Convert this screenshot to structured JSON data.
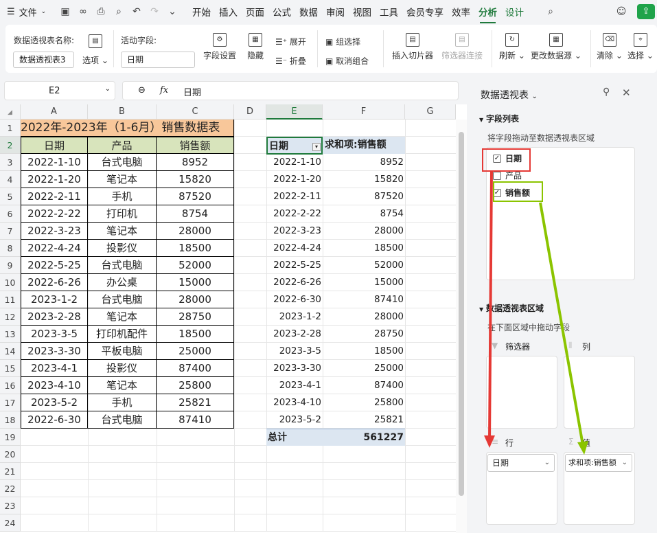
{
  "menu": {
    "file_label": "文件",
    "tabs": [
      "开始",
      "插入",
      "页面",
      "公式",
      "数据",
      "审阅",
      "视图",
      "工具",
      "会员专享",
      "效率",
      "分析",
      "设计"
    ],
    "active_tab": "分析"
  },
  "ribbon": {
    "pivot_name_label": "数据透视表名称:",
    "pivot_name_value": "数据透视表3",
    "options_label": "选项",
    "active_field_label": "活动字段:",
    "active_field_value": "日期",
    "field_settings": "字段设置",
    "hide": "隐藏",
    "expand": "展开",
    "collapse": "折叠",
    "group_select": "组选择",
    "ungroup": "取消组合",
    "insert_slicer": "插入切片器",
    "filter_conn": "筛选器连接",
    "refresh": "刷新",
    "change_source": "更改数据源",
    "clear": "清除",
    "select": "选择"
  },
  "formula_bar": {
    "cell_ref": "E2",
    "fx": "fx",
    "value": "日期"
  },
  "sheet": {
    "columns": [
      "A",
      "B",
      "C",
      "D",
      "E",
      "F",
      "G"
    ],
    "rows": [
      "1",
      "2",
      "3",
      "4",
      "5",
      "6",
      "7",
      "8",
      "9",
      "10",
      "11",
      "12",
      "13",
      "14",
      "15",
      "16",
      "17",
      "18",
      "19",
      "20",
      "21",
      "22",
      "23",
      "24"
    ],
    "title": "2022年-2023年（1-6月）销售数据表",
    "headers": [
      "日期",
      "产品",
      "销售额"
    ],
    "data": [
      [
        "2022-1-10",
        "台式电脑",
        "8952"
      ],
      [
        "2022-1-20",
        "笔记本",
        "15820"
      ],
      [
        "2022-2-11",
        "手机",
        "87520"
      ],
      [
        "2022-2-22",
        "打印机",
        "8754"
      ],
      [
        "2022-3-23",
        "笔记本",
        "28000"
      ],
      [
        "2022-4-24",
        "投影仪",
        "18500"
      ],
      [
        "2022-5-25",
        "台式电脑",
        "52000"
      ],
      [
        "2022-6-26",
        "办公桌",
        "15000"
      ],
      [
        "2023-1-2",
        "台式电脑",
        "28000"
      ],
      [
        "2023-2-28",
        "笔记本",
        "28750"
      ],
      [
        "2023-3-5",
        "打印机配件",
        "18500"
      ],
      [
        "2023-3-30",
        "平板电脑",
        "25000"
      ],
      [
        "2023-4-1",
        "投影仪",
        "87400"
      ],
      [
        "2023-4-10",
        "笔记本",
        "25800"
      ],
      [
        "2023-5-2",
        "手机",
        "25821"
      ],
      [
        "2022-6-30",
        "台式电脑",
        "87410"
      ]
    ]
  },
  "pivot": {
    "header_date": "日期",
    "header_sum": "求和项:销售额",
    "rows": [
      [
        "2022-1-10",
        "8952"
      ],
      [
        "2022-1-20",
        "15820"
      ],
      [
        "2022-2-11",
        "87520"
      ],
      [
        "2022-2-22",
        "8754"
      ],
      [
        "2022-3-23",
        "28000"
      ],
      [
        "2022-4-24",
        "18500"
      ],
      [
        "2022-5-25",
        "52000"
      ],
      [
        "2022-6-26",
        "15000"
      ],
      [
        "2022-6-30",
        "87410"
      ],
      [
        "2023-1-2",
        "28000"
      ],
      [
        "2023-2-28",
        "28750"
      ],
      [
        "2023-3-5",
        "18500"
      ],
      [
        "2023-3-30",
        "25000"
      ],
      [
        "2023-4-1",
        "87400"
      ],
      [
        "2023-4-10",
        "25800"
      ],
      [
        "2023-5-2",
        "25821"
      ]
    ],
    "total_label": "总计",
    "total_value": "561227"
  },
  "panel": {
    "title": "数据透视表",
    "field_list": "字段列表",
    "drag_hint": "将字段拖动至数据透视表区域",
    "fields": [
      {
        "label": "日期",
        "checked": true
      },
      {
        "label": "产品",
        "checked": false
      },
      {
        "label": "销售额",
        "checked": true
      }
    ],
    "area_title": "数据透视表区域",
    "area_hint": "在下面区域中拖动字段",
    "filter_label": "筛选器",
    "column_label": "列",
    "row_label": "行",
    "value_label": "值",
    "row_value": "日期",
    "value_value": "求和项:销售额"
  },
  "colors": {
    "title_fill": "#f8c79a",
    "header_fill": "#d8e4bc",
    "pivot_header_fill": "#dce6f1",
    "accent_green": "#1f7a3c",
    "highlight_red": "#e53935",
    "highlight_lime": "#8bc400"
  }
}
